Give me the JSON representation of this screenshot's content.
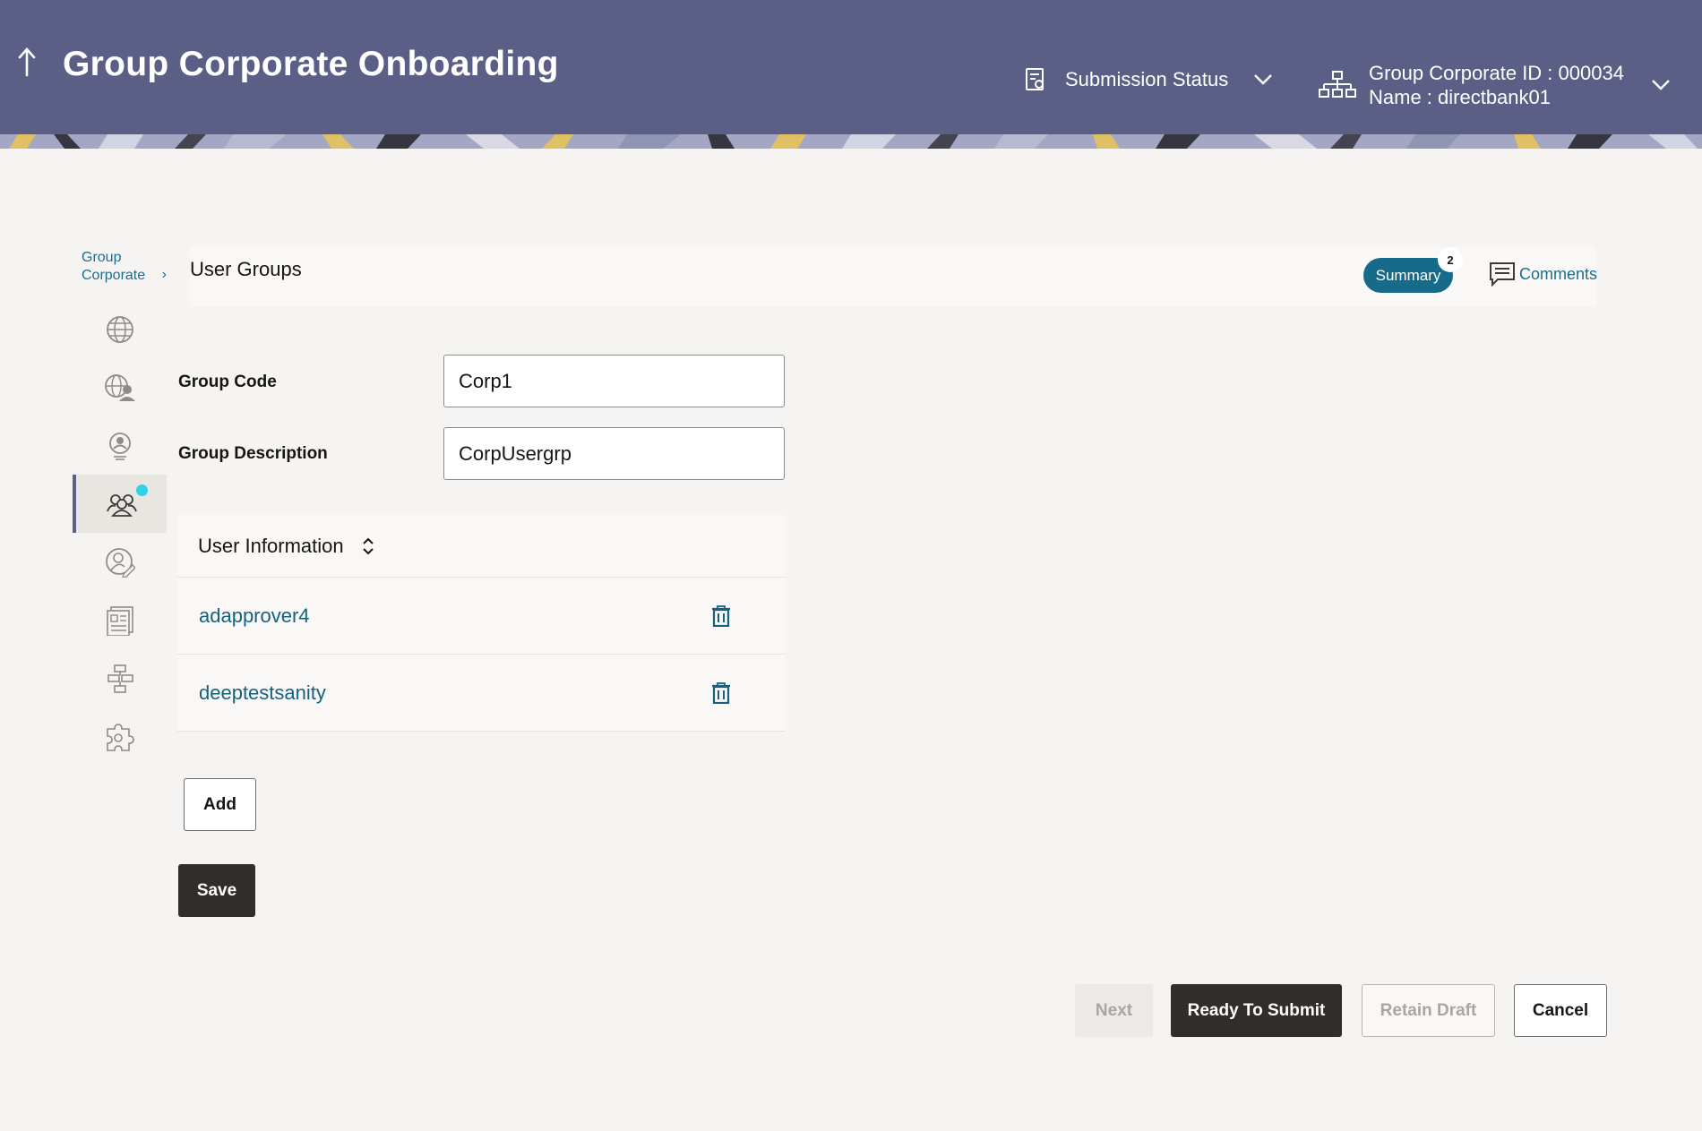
{
  "header": {
    "title": "Group Corporate Onboarding",
    "submission_status": "Submission Status",
    "corporate_id": "Group Corporate ID : 000034",
    "corporate_name": "Name : directbank01"
  },
  "breadcrumb": {
    "parent": "Group Corporate",
    "arrow": "›"
  },
  "page": {
    "title": "User Groups",
    "summary_label": "Summary",
    "summary_count": "2",
    "comments_label": "Comments"
  },
  "sidebar": {
    "items": [
      {
        "icon": "globe-icon"
      },
      {
        "icon": "globe-users-icon"
      },
      {
        "icon": "user-profile-icon"
      },
      {
        "icon": "user-group-icon",
        "active": true
      },
      {
        "icon": "user-edit-icon"
      },
      {
        "icon": "document-report-icon"
      },
      {
        "icon": "workflow-icon"
      },
      {
        "icon": "settings-puzzle-icon"
      }
    ]
  },
  "form": {
    "group_code_label": "Group Code",
    "group_code_value": "Corp1",
    "group_description_label": "Group Description",
    "group_description_value": "CorpUsergrp"
  },
  "user_information": {
    "header": "User Information",
    "users": [
      {
        "name": "adapprover4"
      },
      {
        "name": "deeptestsanity"
      }
    ]
  },
  "actions": {
    "add": "Add",
    "save": "Save",
    "next": "Next",
    "ready_to_submit": "Ready To Submit",
    "retain_draft": "Retain Draft",
    "cancel": "Cancel"
  },
  "colors": {
    "header_bg": "#5b5f85",
    "accent": "#166a8a",
    "dark_button": "#312d2a",
    "notification_dot": "#2fd3e8"
  }
}
